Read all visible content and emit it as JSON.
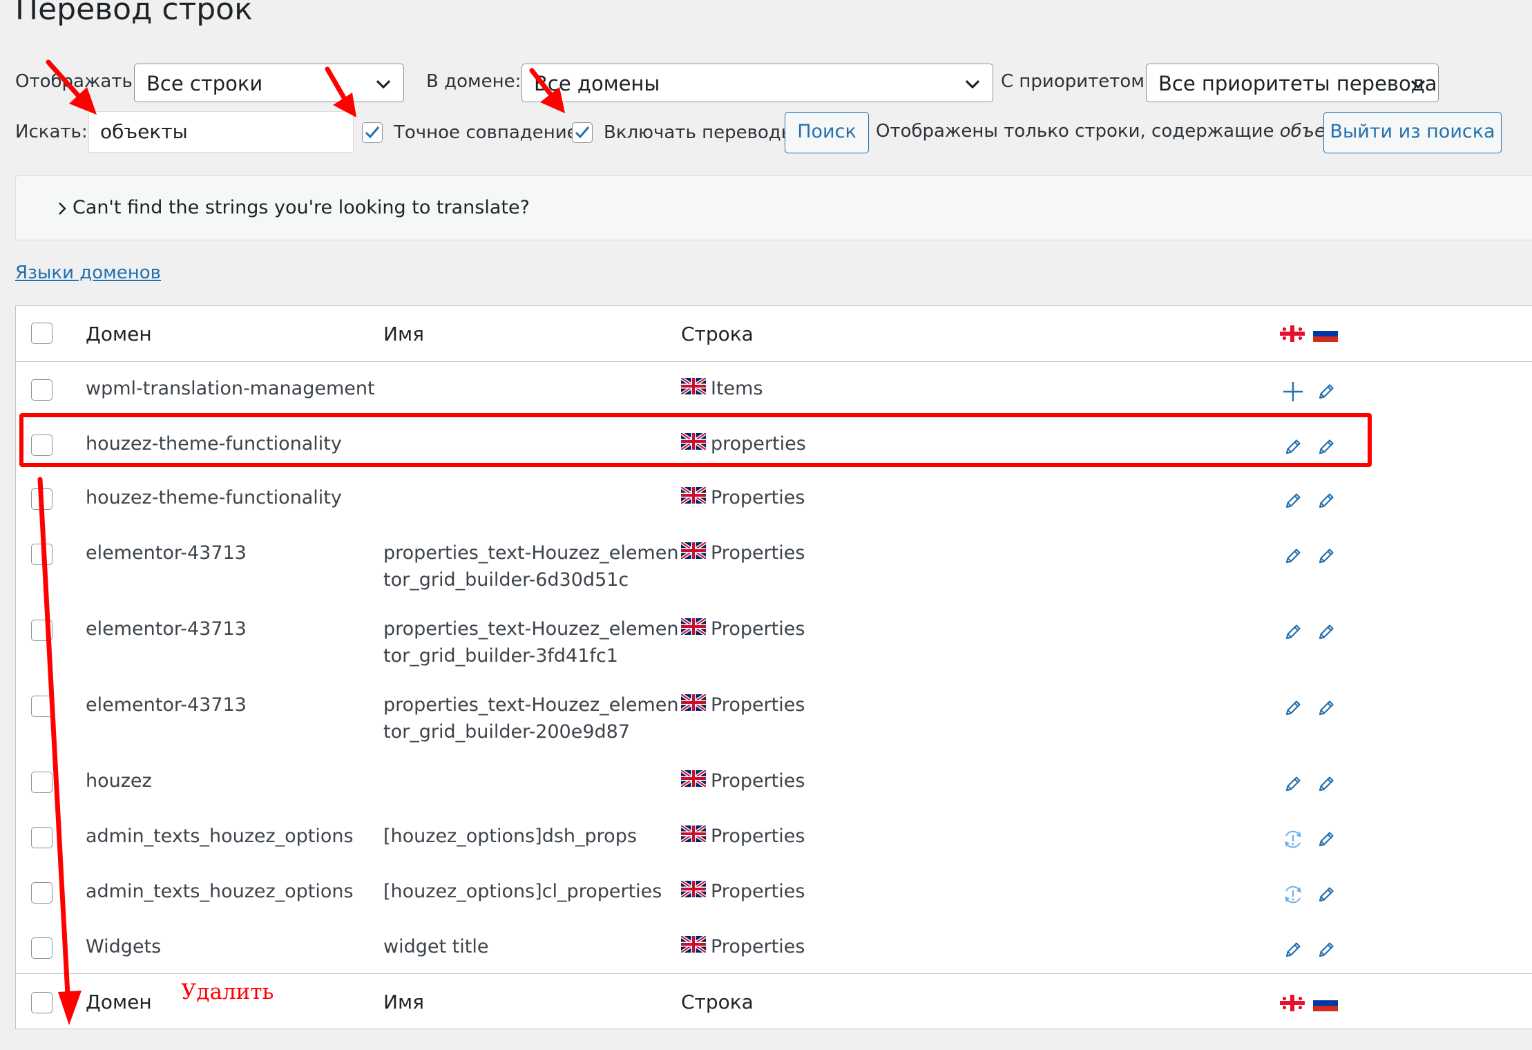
{
  "page": {
    "title": "Перевод строк",
    "show_label": "Отображать:",
    "show_value": "Все строки",
    "domain_label": "В домене:",
    "domain_value": "Все домены",
    "priority_label": "С приоритетом:",
    "priority_value": "Все приоритеты перевода",
    "search_label": "Искать:",
    "search_value": "объекты",
    "exact_match_label": "Точное совпадение",
    "include_translations_label": "Включать переводы",
    "search_button": "Поиск",
    "status_text": "Отображены только строки, содержащие",
    "status_term": "объекты",
    "exit_search_button": "Выйти из поиска",
    "exact_match_checked": true,
    "include_translations_checked": true
  },
  "infobox": {
    "text": "Can't find the strings you're looking to translate?"
  },
  "domain_languages_link": "Языки доменов",
  "table": {
    "headers": {
      "domain": "Домен",
      "name": "Имя",
      "string": "Строка"
    },
    "language_flags": [
      "georgia-flag-icon",
      "russia-flag-icon"
    ],
    "rows": [
      {
        "domain": "wpml-translation-management",
        "name_l1": "",
        "name_l2": "",
        "string": "Items",
        "status1": "add",
        "status2": "edit"
      },
      {
        "domain": "houzez-theme-functionality",
        "name_l1": "",
        "name_l2": "",
        "string": "properties",
        "status1": "edit",
        "status2": "edit"
      },
      {
        "domain": "houzez-theme-functionality",
        "name_l1": "",
        "name_l2": "",
        "string": "Properties",
        "status1": "edit",
        "status2": "edit"
      },
      {
        "domain": "elementor-43713",
        "name_l1": "properties_text-Houzez_elemen",
        "name_l2": "tor_grid_builder-6d30d51c",
        "string": "Properties",
        "status1": "edit",
        "status2": "edit"
      },
      {
        "domain": "elementor-43713",
        "name_l1": "properties_text-Houzez_elemen",
        "name_l2": "tor_grid_builder-3fd41fc1",
        "string": "Properties",
        "status1": "edit",
        "status2": "edit"
      },
      {
        "domain": "elementor-43713",
        "name_l1": "properties_text-Houzez_elemen",
        "name_l2": "tor_grid_builder-200e9d87",
        "string": "Properties",
        "status1": "edit",
        "status2": "edit"
      },
      {
        "domain": "houzez",
        "name_l1": "",
        "name_l2": "",
        "string": "Properties",
        "status1": "edit",
        "status2": "edit"
      },
      {
        "domain": "admin_texts_houzez_options",
        "name_l1": "[houzez_options]dsh_props",
        "name_l2": "",
        "string": "Properties",
        "status1": "in-progress",
        "status2": "edit"
      },
      {
        "domain": "admin_texts_houzez_options",
        "name_l1": "[houzez_options]cl_properties",
        "name_l2": "",
        "string": "Properties",
        "status1": "in-progress",
        "status2": "edit"
      },
      {
        "domain": "Widgets",
        "name_l1": "widget title",
        "name_l2": "",
        "string": "Properties",
        "status1": "edit",
        "status2": "edit"
      }
    ]
  },
  "annotation": {
    "delete_label": "Удалить",
    "color": "#ff0000"
  },
  "colors": {
    "accent": "#2271b1",
    "annotation": "#ff0000"
  }
}
